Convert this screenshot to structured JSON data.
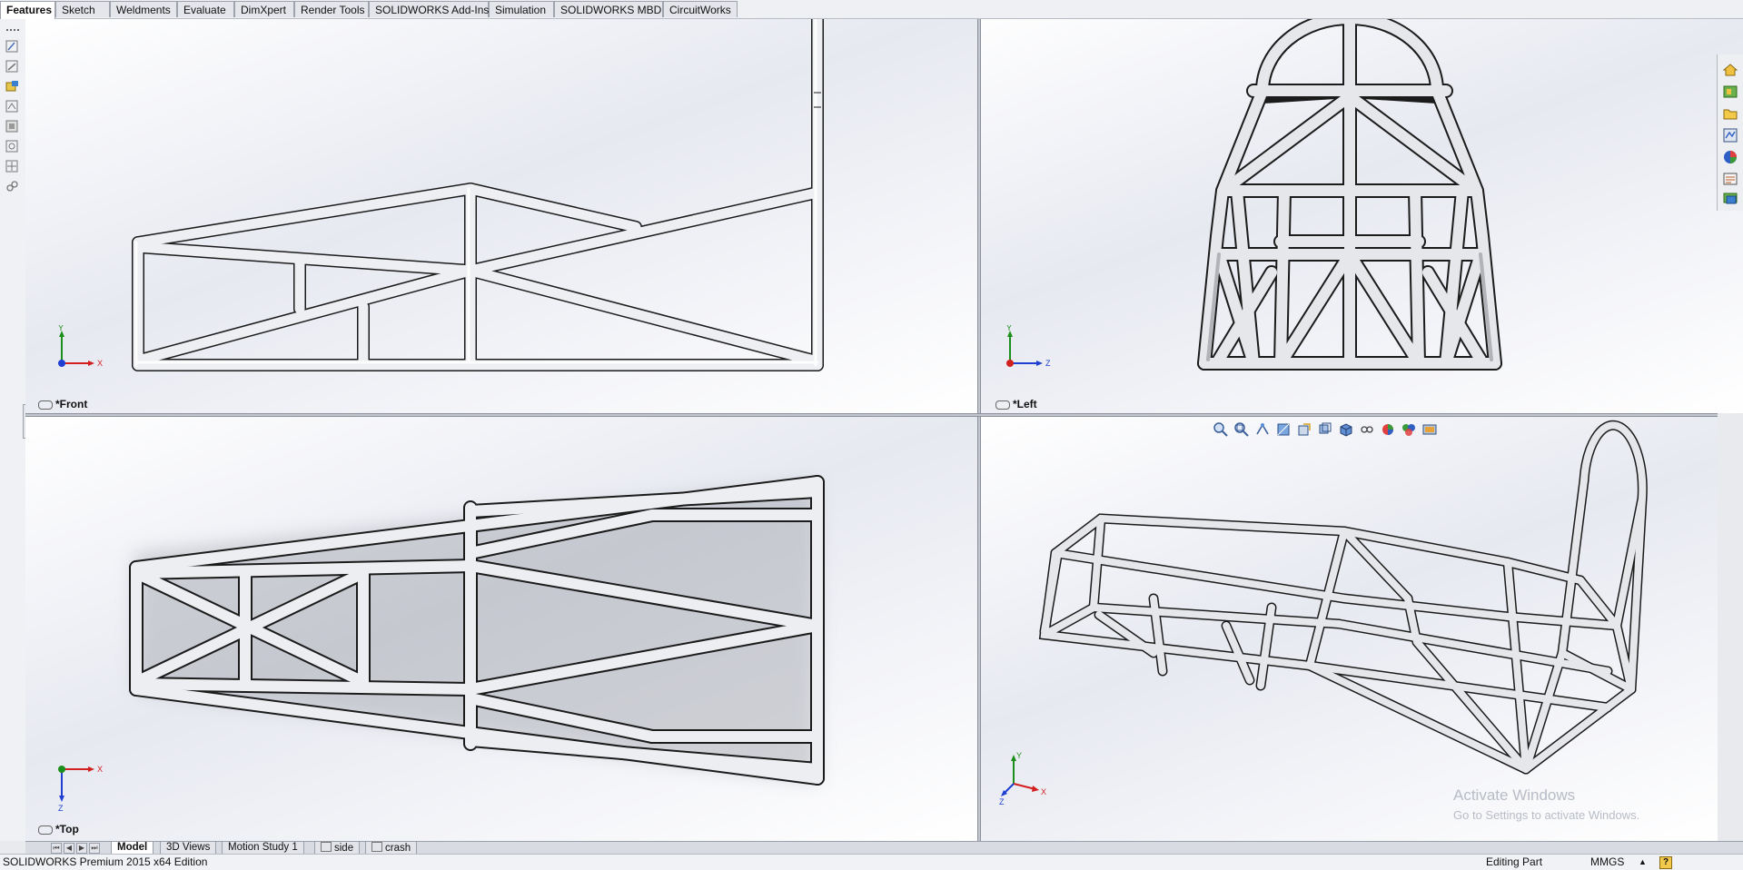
{
  "command_tabs": [
    "Features",
    "Sketch",
    "Weldments",
    "Evaluate",
    "DimXpert",
    "Render Tools",
    "SOLIDWORKS Add-Ins",
    "Simulation",
    "SOLIDWORKS MBD",
    "CircuitWorks"
  ],
  "active_tab": "Features",
  "viewports": {
    "front": {
      "label": "*Front",
      "triad": [
        "Y",
        "X"
      ]
    },
    "left": {
      "label": "*Left",
      "triad": [
        "Y",
        "Z"
      ]
    },
    "top": {
      "label": "*Top",
      "triad": [
        "Z",
        "X"
      ]
    },
    "iso": {
      "label": "",
      "triad": [
        "Y",
        "Z",
        "X"
      ]
    }
  },
  "heads_up_toolbar": [
    "zoom-to-fit-icon",
    "zoom-area-icon",
    "previous-view-icon",
    "section-view-icon",
    "dynamic-annotation-icon",
    "view-orientation-icon",
    "display-style-icon",
    "hide-show-items-icon",
    "edit-appearance-icon",
    "apply-scene-icon",
    "view-settings-icon"
  ],
  "task_pane": [
    "solidworks-resources-icon",
    "design-library-icon",
    "file-explorer-icon",
    "view-palette-icon",
    "appearances-icon",
    "custom-properties-icon",
    "solidworks-forum-icon"
  ],
  "bottom_tabs": [
    {
      "label": "Model",
      "active": true
    },
    {
      "label": "3D Views",
      "active": false
    },
    {
      "label": "Motion Study 1",
      "active": false
    },
    {
      "label": "side",
      "active": false
    },
    {
      "label": "crash",
      "active": false
    }
  ],
  "status": {
    "left": "SOLIDWORKS Premium 2015 x64 Edition",
    "mode": "Editing Part",
    "units": "MMGS",
    "units_arrow": "▲",
    "help": "?"
  },
  "watermark": {
    "title": "Activate Windows",
    "subtitle": "Go to Settings to activate Windows."
  },
  "colors": {
    "tube_fill": "#e8e9ec",
    "tube_shade": "#8b8d93",
    "tube_edge": "#1a1a1a",
    "axis_x": "#d21f1f",
    "axis_y": "#1b8f1b",
    "axis_z": "#1f3fd2"
  }
}
